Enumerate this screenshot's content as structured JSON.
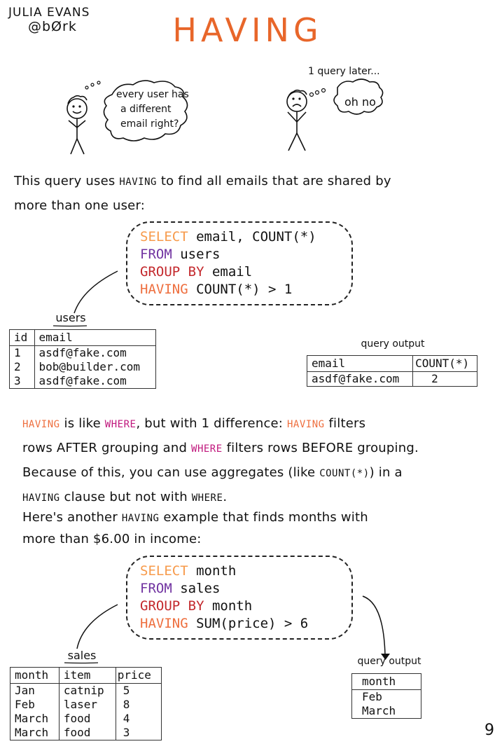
{
  "header": {
    "author_name": "JULIA EVANS",
    "author_handle": "@bØrk",
    "title": "HAVING"
  },
  "comic": {
    "left_thought": [
      "every user has",
      "a different",
      "email right?"
    ],
    "right_caption": "1 query later...",
    "right_thought": "oh no"
  },
  "intro": {
    "line1_pre": "This query uses ",
    "line1_kw": "HAVING",
    "line1_post": " to find all emails that are shared by",
    "line2": "more than one user:"
  },
  "query1": {
    "lines": [
      {
        "kw": "SELECT",
        "rest": " email, COUNT(*)"
      },
      {
        "kw": "FROM",
        "rest": " users"
      },
      {
        "kw": "GROUP BY",
        "rest": " email"
      },
      {
        "kw": "HAVING",
        "rest": " COUNT(*) > 1"
      }
    ]
  },
  "users_table": {
    "label": "users",
    "columns": [
      "id",
      "email"
    ],
    "rows": [
      [
        "1",
        "asdf@fake.com"
      ],
      [
        "2",
        "bob@builder.com"
      ],
      [
        "3",
        "asdf@fake.com"
      ]
    ]
  },
  "output1": {
    "label": "query output",
    "columns": [
      "email",
      "COUNT(*)"
    ],
    "rows": [
      [
        "asdf@fake.com",
        "2"
      ]
    ]
  },
  "explanation": {
    "l1_kw1": "HAVING",
    "l1_t1": " is like ",
    "l1_kw2": "WHERE",
    "l1_t2": ",  but with 1 difference: ",
    "l1_kw3": "HAVING",
    "l1_t3": " filters",
    "l2_t1": "rows AFTER grouping and ",
    "l2_kw": "WHERE",
    "l2_t2": " filters rows BEFORE grouping.",
    "l3_t1": "Because of this, you can use aggregates (like ",
    "l3_kw": "COUNT(*)",
    "l3_t2": ") in a",
    "l4_kw1": "HAVING",
    "l4_t1": " clause but not with ",
    "l4_kw2": "WHERE",
    "l4_t2": "."
  },
  "intro2": {
    "line1_pre": "Here's another ",
    "line1_kw": "HAVING",
    "line1_post": " example that finds months with",
    "line2": "more than $6.00 in income:"
  },
  "query2": {
    "lines": [
      {
        "kw": "SELECT",
        "rest": " month"
      },
      {
        "kw": "FROM",
        "rest": " sales"
      },
      {
        "kw": "GROUP BY",
        "rest": " month"
      },
      {
        "kw": "HAVING",
        "rest": " SUM(price) > 6"
      }
    ]
  },
  "sales_table": {
    "label": "sales",
    "columns": [
      "month",
      "item",
      "price"
    ],
    "rows": [
      [
        "Jan",
        "catnip",
        "5"
      ],
      [
        "Feb",
        "laser",
        "8"
      ],
      [
        "March",
        "food",
        "4"
      ],
      [
        "March",
        "food",
        "3"
      ]
    ]
  },
  "output2": {
    "label": "query output",
    "columns": [
      "month"
    ],
    "rows": [
      [
        "Feb"
      ],
      [
        "March"
      ]
    ]
  },
  "page_number": "9",
  "colors": {
    "title": "#e8662a",
    "select": "#f79a4a",
    "from": "#7032a0",
    "group_by": "#c3282c",
    "having": "#ee6f3f",
    "where": "#c0187d"
  }
}
